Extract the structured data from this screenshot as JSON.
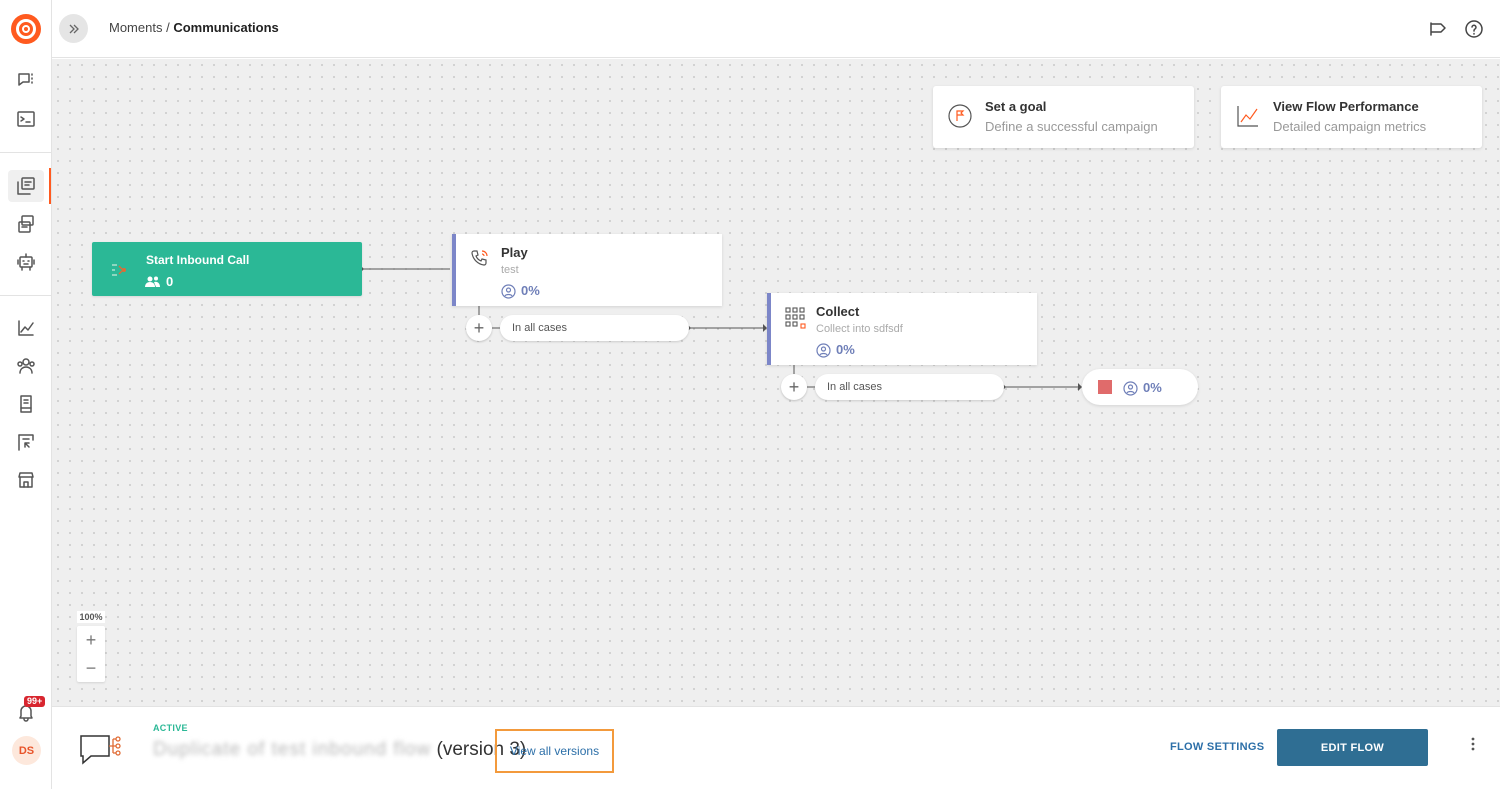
{
  "breadcrumb": {
    "parent": "Moments",
    "separator": " / ",
    "current": "Communications"
  },
  "canvas": {
    "goal_card": {
      "title": "Set a goal",
      "subtitle": "Define a successful campaign"
    },
    "performance_card": {
      "title": "View Flow Performance",
      "subtitle": "Detailed campaign metrics"
    },
    "start_node": {
      "title": "Start Inbound Call",
      "count": "0"
    },
    "play_node": {
      "title": "Play",
      "subtitle": "test",
      "pct": "0%",
      "case_label": "In all cases"
    },
    "collect_node": {
      "title": "Collect",
      "subtitle": "Collect into sdfsdf",
      "pct": "0%",
      "case_label": "In all cases"
    },
    "end_node": {
      "pct": "0%"
    },
    "zoom": {
      "level": "100%",
      "zoom_in": "+",
      "zoom_out": "−"
    }
  },
  "sidebar": {
    "notification_badge": "99+",
    "avatar_initials": "DS"
  },
  "footer": {
    "status": "ACTIVE",
    "flow_name_blurred": "Duplicate of test inbound flow",
    "version": "(version 3)",
    "view_versions": "View all versions",
    "flow_settings": "FLOW SETTINGS",
    "edit_flow": "EDIT FLOW"
  },
  "colors": {
    "brand": "#ff5a1f",
    "start_node": "#2bb896",
    "node_accent": "#7c86c8",
    "primary_button": "#2f6e93",
    "link": "#2c6fa8",
    "focus_outline": "#f39a3c"
  }
}
